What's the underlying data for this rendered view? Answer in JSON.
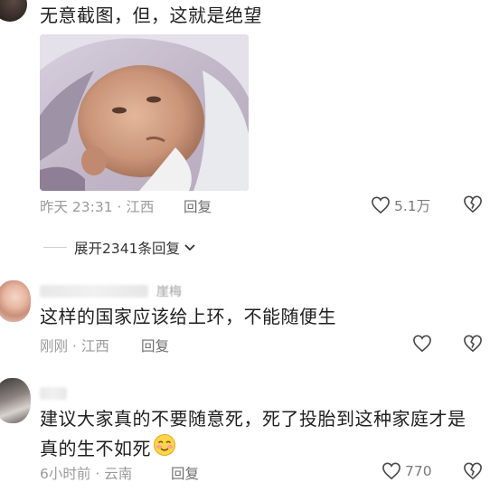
{
  "comments": [
    {
      "text": "无意截图，但，这就是绝望",
      "time": "昨天 23:31",
      "location": "江西",
      "reply_label": "回复",
      "likes": "5.1万"
    },
    {
      "username": "崖梅",
      "text": "这样的国家应该给上环，不能随便生",
      "time": "刚刚",
      "location": "江西",
      "reply_label": "回复"
    },
    {
      "text_line1": "建议大家真的不要随意死，死了投胎到这种家庭才是",
      "text_line2": "真的生不如死",
      "time": "6小时前",
      "location": "云南",
      "reply_label": "回复",
      "likes": "770"
    }
  ],
  "expand_replies": "展开2341条回复",
  "separator": "·",
  "icons": {
    "like": "heart-outline-icon",
    "dislike": "broken-heart-icon",
    "expand": "chevron-down-icon",
    "emoji": "blushing-smile-emoji"
  },
  "colors": {
    "text": "#1f1f1f",
    "meta": "#9a9a9a",
    "icon": "#4a4a4a"
  }
}
